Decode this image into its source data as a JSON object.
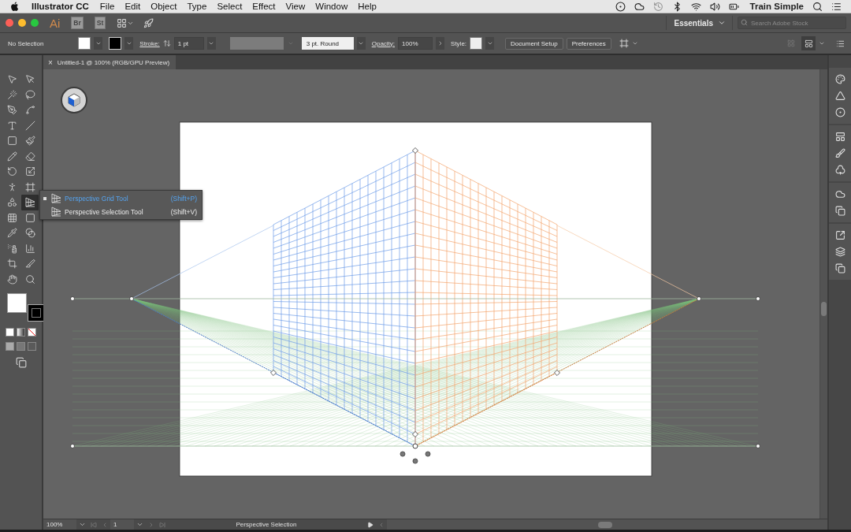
{
  "menu_bar": {
    "app_name": "Illustrator CC",
    "menus": [
      "File",
      "Edit",
      "Object",
      "Type",
      "Select",
      "Effect",
      "View",
      "Window",
      "Help"
    ],
    "user": "Train Simple"
  },
  "app_bar": {
    "logo": "Ai",
    "bridge": "Br",
    "stock": "St",
    "workspace": "Essentials",
    "search": {
      "placeholder": "Search Adobe Stock"
    }
  },
  "control_bar": {
    "selection": "No Selection",
    "stroke_label": "Stroke:",
    "stroke_weight": "1 pt",
    "brush": "3 pt. Round",
    "opacity_label": "Opacity:",
    "opacity": "100%",
    "style_label": "Style:",
    "buttons": [
      "Document Setup",
      "Preferences"
    ]
  },
  "document_tab": {
    "close": "×",
    "title": "Untitled-1 @ 100% (RGB/GPU Preview)"
  },
  "tools": [
    {
      "kind": "selection",
      "selected": false
    },
    {
      "kind": "direct-selection",
      "selected": false
    },
    {
      "kind": "magic-wand",
      "selected": false
    },
    {
      "kind": "lasso",
      "selected": false
    },
    {
      "kind": "pen",
      "selected": false
    },
    {
      "kind": "curvature",
      "selected": false
    },
    {
      "kind": "type",
      "selected": false
    },
    {
      "kind": "line",
      "selected": false
    },
    {
      "kind": "rectangle",
      "selected": false
    },
    {
      "kind": "paintbrush",
      "selected": false
    },
    {
      "kind": "shaper",
      "selected": false
    },
    {
      "kind": "eraser",
      "selected": false
    },
    {
      "kind": "rotate",
      "selected": false
    },
    {
      "kind": "scale",
      "selected": false
    },
    {
      "kind": "puppet-warp",
      "selected": false
    },
    {
      "kind": "free-transform",
      "selected": false
    },
    {
      "kind": "shape-builder",
      "selected": false
    },
    {
      "kind": "perspective-grid",
      "selected": true
    },
    {
      "kind": "mesh",
      "selected": false
    },
    {
      "kind": "gradient",
      "selected": false
    },
    {
      "kind": "eyedropper",
      "selected": false
    },
    {
      "kind": "blend",
      "selected": false
    },
    {
      "kind": "symbol-sprayer",
      "selected": false
    },
    {
      "kind": "graph",
      "selected": false
    },
    {
      "kind": "artboard",
      "selected": false
    },
    {
      "kind": "slice",
      "selected": false
    },
    {
      "kind": "hand",
      "selected": false
    },
    {
      "kind": "zoom",
      "selected": false
    }
  ],
  "tool_flyout": [
    {
      "label": "Perspective Grid Tool",
      "shortcut": "(Shift+P)",
      "selected": true
    },
    {
      "label": "Perspective Selection Tool",
      "shortcut": "(Shift+V)",
      "selected": false
    }
  ],
  "status_bar": {
    "zoom": "100%",
    "artboard": "1",
    "status": "Perspective Selection"
  }
}
